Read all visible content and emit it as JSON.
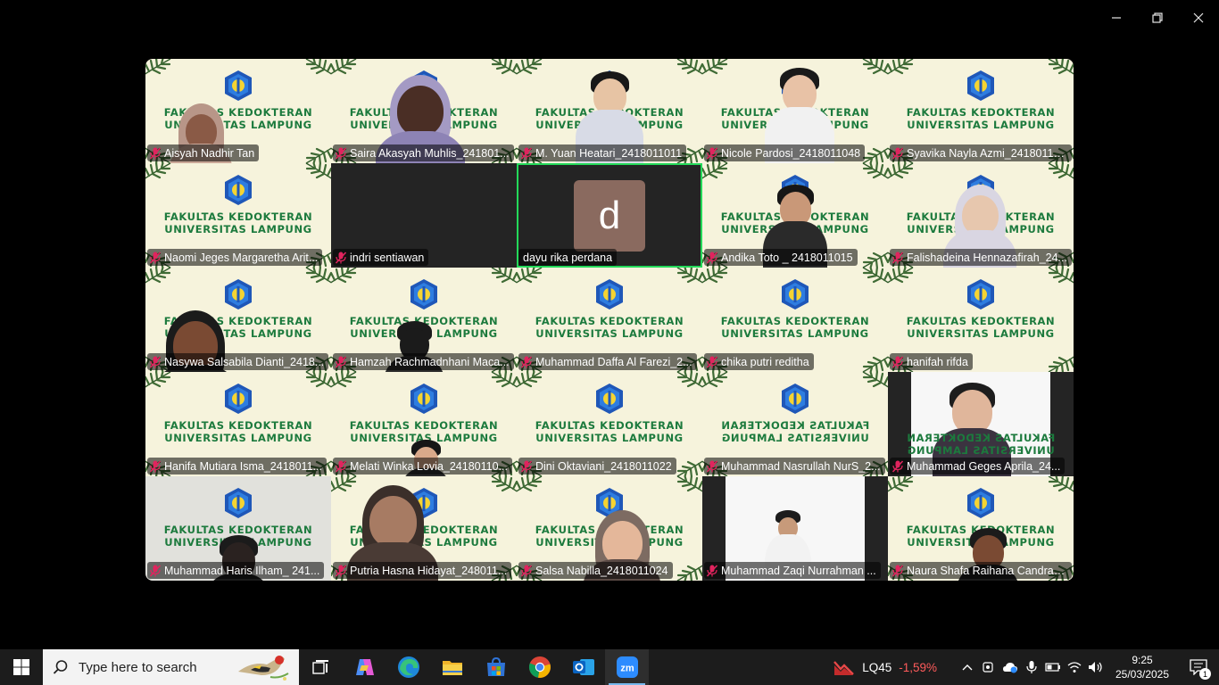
{
  "window": {
    "minimize_icon": "minimize-icon",
    "restore_icon": "restore-icon",
    "close_icon": "close-icon"
  },
  "background": {
    "line1": "FAKULTAS KEDOKTERAN",
    "line2": "UNIVERSITAS LAMPUNG"
  },
  "participants": [
    {
      "name": "Aisyah Nadhir Tan",
      "muted": true
    },
    {
      "name": "Saira Akasyah Muhlis_241801...",
      "muted": true
    },
    {
      "name": "M. Yuan Heatari_2418011011",
      "muted": true
    },
    {
      "name": "Nicole Pardosi_2418011048",
      "muted": true
    },
    {
      "name": "Syavika Nayla Azmi_24180110...",
      "muted": true
    },
    {
      "name": "Naomi Jeges Margaretha Arit...",
      "muted": true
    },
    {
      "name": "indri sentiawan",
      "muted": true
    },
    {
      "name": "dayu rika perdana",
      "muted": false,
      "avatar_letter": "d"
    },
    {
      "name": "Andika Toto _ 2418011015",
      "muted": true
    },
    {
      "name": "Falishadeina Hennazafirah_24...",
      "muted": true
    },
    {
      "name": "Nasywa Salsabila Dianti_2418...",
      "muted": true
    },
    {
      "name": "Hamzah Rachmadnhani Maca...",
      "muted": true
    },
    {
      "name": "Muhammad Daffa Al Farezi_2...",
      "muted": true
    },
    {
      "name": "chika putri reditha",
      "muted": true
    },
    {
      "name": "hanifah rifda",
      "muted": true
    },
    {
      "name": "Hanifa Mutiara Isma_2418011...",
      "muted": true
    },
    {
      "name": "Melati Winka Lovia_24180110...",
      "muted": true
    },
    {
      "name": "Dini Oktaviani_2418011022",
      "muted": true
    },
    {
      "name": "Muhammad Nasrullah NurS_2...",
      "muted": true
    },
    {
      "name": "Muhammad Geges Aprila_24...",
      "muted": true
    },
    {
      "name": "Muhammad Haris Ilham_ 241...",
      "muted": true
    },
    {
      "name": "Putria Hasna Hidayat_248011...",
      "muted": true
    },
    {
      "name": "Salsa Nabilla_2418011024",
      "muted": true
    },
    {
      "name": "Muhammad Zaqi Nurrahman ...",
      "muted": true
    },
    {
      "name": "Naura Shafa Raihana Candrak...",
      "muted": true
    }
  ],
  "taskbar": {
    "search_placeholder": "Type here to search",
    "apps": [
      "task-view-icon",
      "copilot-icon",
      "edge-icon",
      "file-explorer-icon",
      "store-icon",
      "chrome-icon",
      "outlook-icon",
      "zoom-icon"
    ],
    "stock_symbol": "LQ45",
    "stock_change": "-1,59%",
    "time": "9:25",
    "date": "25/03/2025",
    "notification_count": "1"
  },
  "colors": {
    "active_speaker": "#23d959",
    "muted_mic": "#e0245e",
    "vbg": "#f6f3dc",
    "vbg_text": "#1c7a3d"
  }
}
